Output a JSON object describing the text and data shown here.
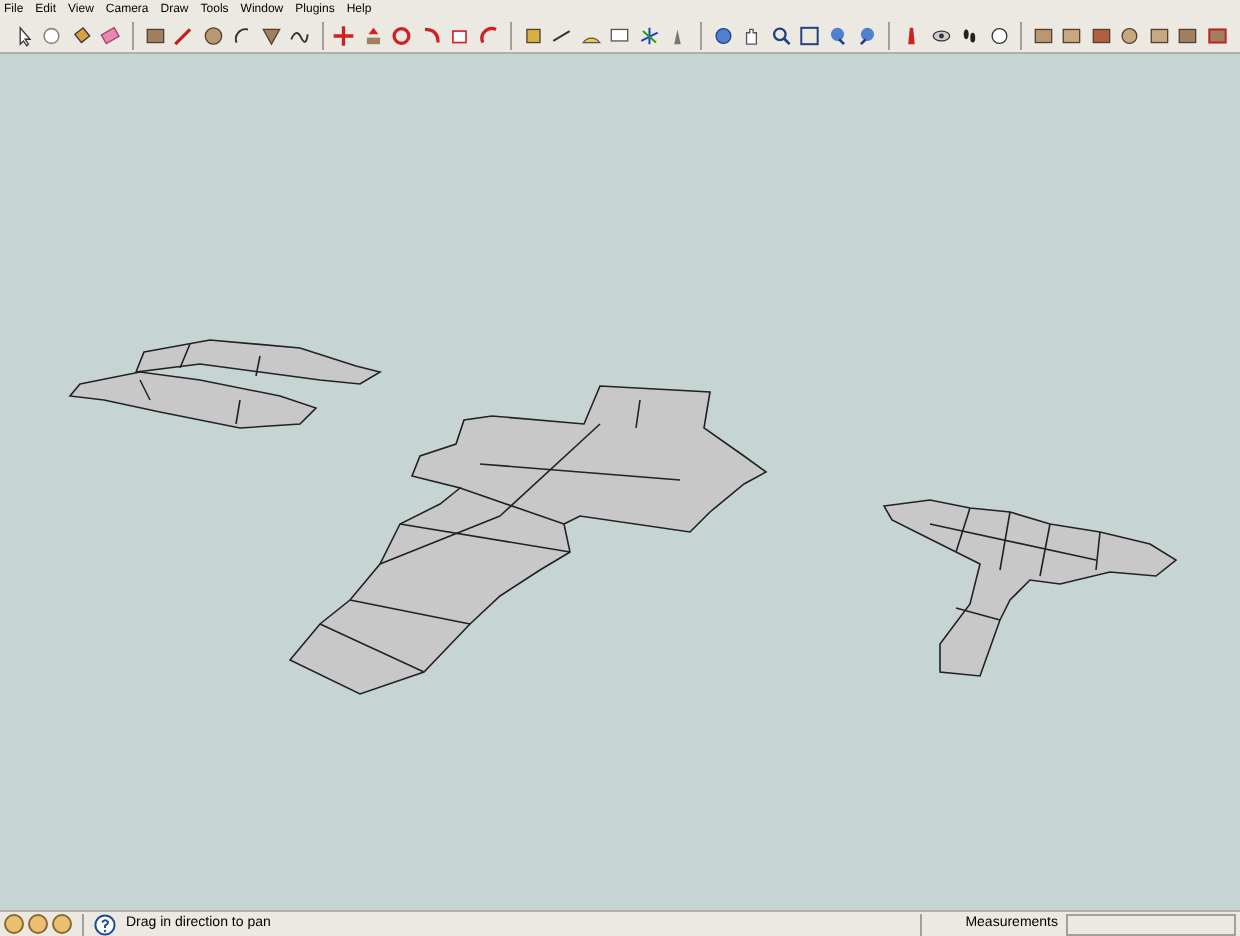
{
  "menu_bar": [
    "File",
    "Edit",
    "View",
    "Camera",
    "Draw",
    "Tools",
    "Window",
    "Plugins",
    "Help"
  ],
  "status_bar": {
    "message": "Drag in direction to pan",
    "measurements_label": "Measurements"
  }
}
